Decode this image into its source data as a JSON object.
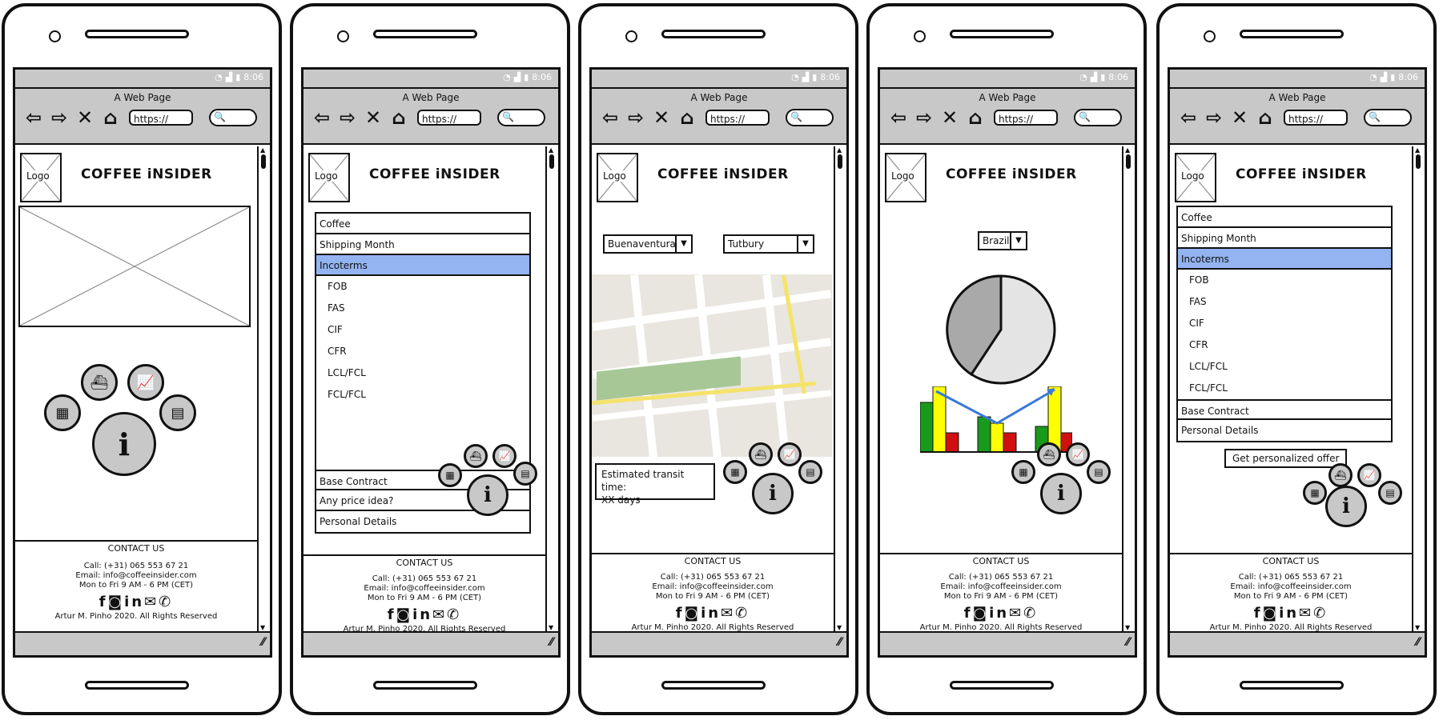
{
  "app": {
    "window_title": "A Web Page",
    "status_time": "8:06",
    "url_text": "https://",
    "brand": "COFFEE iNSIDER",
    "logo_label": "Logo"
  },
  "footer": {
    "contact": "CONTACT US",
    "call": "Call: (+31) 065 553 67 21",
    "email": "Email: info@coffeeinsider.com",
    "hours": "Mon to Fri 9 AM  - 6 PM (CET)",
    "copyright": "Artur M. Pinho 2020. All Rights Reserved",
    "social": [
      "facebook-icon",
      "instagram-icon",
      "linkedin-icon",
      "mail-icon",
      "whatsapp-icon"
    ]
  },
  "menu_phone2": {
    "top_items": [
      "Coffee",
      "Shipping Month",
      "Incoterms"
    ],
    "sub_items": [
      "FOB",
      "FAS",
      "CIF",
      "CFR",
      "LCL/FCL",
      "FCL/FCL"
    ],
    "bottom_items": [
      "Base Contract",
      "Any price idea?",
      "Personal Details"
    ]
  },
  "menu_phone5": {
    "top_items": [
      "Coffee",
      "Shipping Month",
      "Incoterms"
    ],
    "sub_items": [
      "FOB",
      "FAS",
      "CIF",
      "CFR",
      "LCL/FCL",
      "FCL/FCL"
    ],
    "bottom_items": [
      "Base Contract",
      "Personal Details"
    ],
    "offer_button": "Get personalized offer"
  },
  "route": {
    "origin": "Buenaventura",
    "destination": "Tutbury",
    "transit_line1": "Estimated transit time:",
    "transit_line2": "XX days"
  },
  "origin_stats": {
    "country": "Brazil"
  },
  "icons": {
    "calculator": "▦",
    "ship": "⛴",
    "chart": "📈",
    "news": "▤",
    "info": "i"
  },
  "colors": {
    "selected": "#93b4f0",
    "chrome": "#c8c8c8",
    "green": "#1a9a1a",
    "yellow": "#ffff00",
    "red": "#d01010",
    "line": "#3a78d8"
  }
}
